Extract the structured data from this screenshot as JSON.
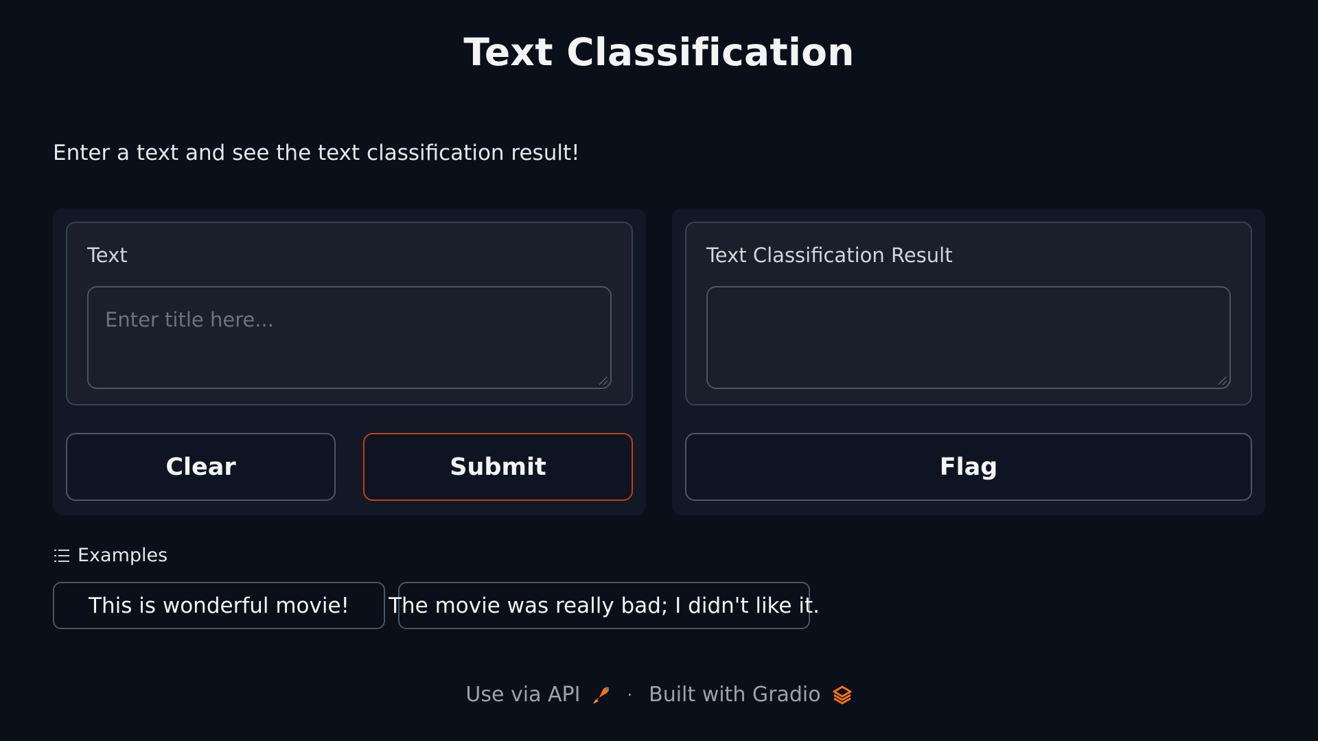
{
  "header": {
    "title": "Text Classification",
    "description": "Enter a text and see the text classification result!"
  },
  "input_panel": {
    "label": "Text",
    "placeholder": "Enter title here...",
    "value": "",
    "clear_label": "Clear",
    "submit_label": "Submit"
  },
  "output_panel": {
    "label": "Text Classification Result",
    "value": "",
    "flag_label": "Flag"
  },
  "examples": {
    "heading": "Examples",
    "items": [
      "This is wonderful movie!",
      "The movie was really bad; I didn't like it."
    ]
  },
  "footer": {
    "api_label": "Use via API",
    "separator": "·",
    "built_label": "Built with Gradio"
  },
  "colors": {
    "background": "#0b0f19",
    "accent": "#f97316",
    "submit_border": "#c2410c"
  },
  "icons": {
    "examples": "list-icon",
    "api": "rocket-icon",
    "gradio": "gradio-logo-icon"
  }
}
